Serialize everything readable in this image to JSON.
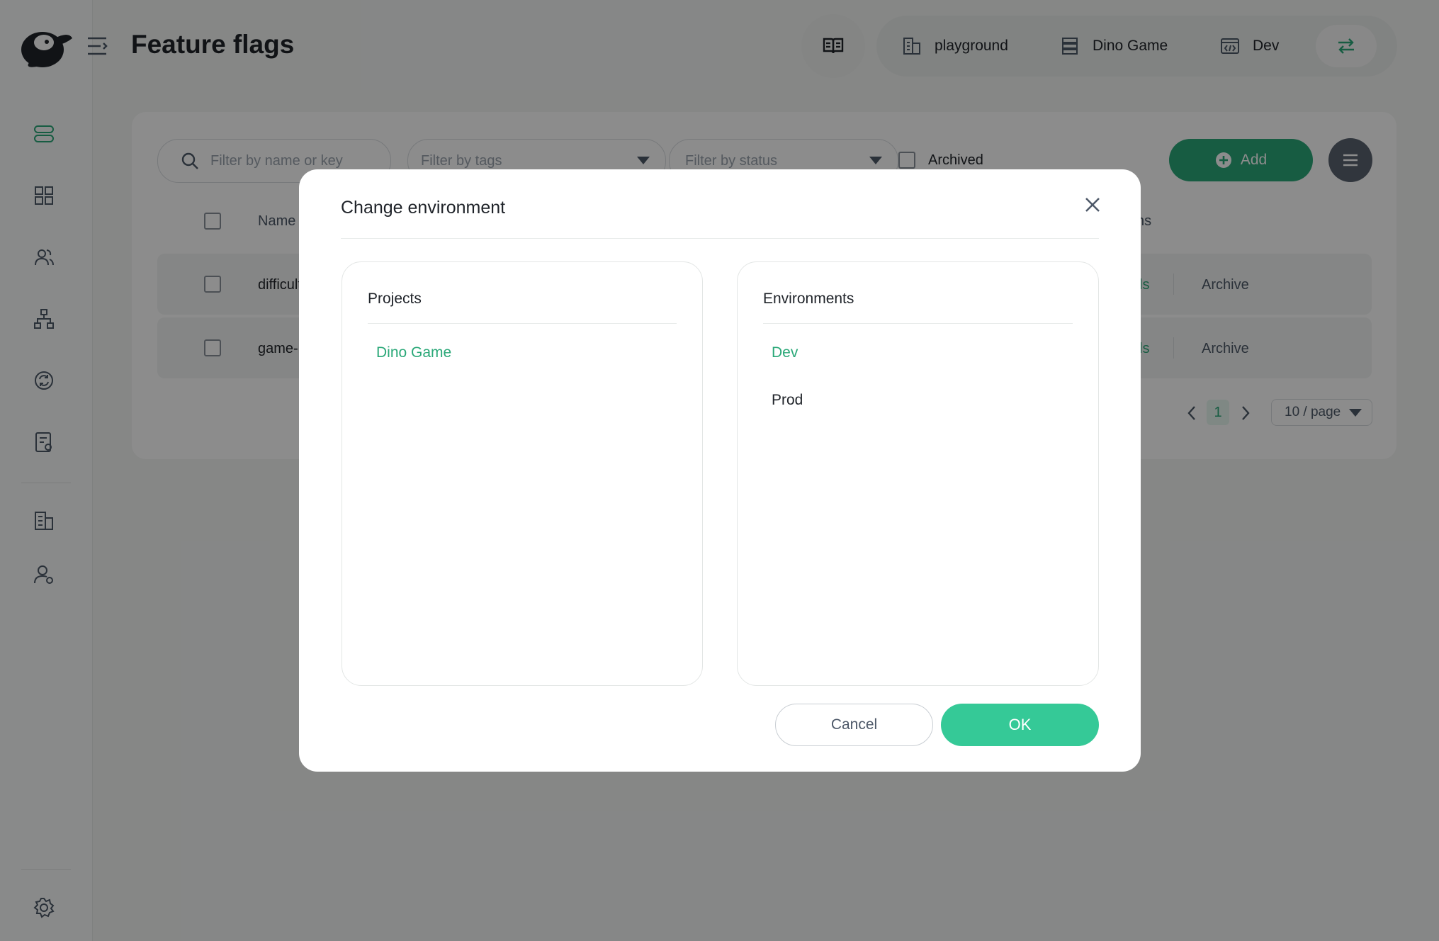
{
  "app": {
    "title": "Feature flags"
  },
  "header": {
    "organization": "playground",
    "project": "Dino Game",
    "environment": "Dev"
  },
  "filters": {
    "search_placeholder": "Filter by name or key",
    "tags_placeholder": "Filter by tags",
    "status_placeholder": "Filter by status",
    "archived_label": "Archived",
    "add_label": "Add"
  },
  "table": {
    "columns": {
      "name": "Name",
      "actions": "ns"
    },
    "rows": [
      {
        "name": "difficult",
        "details": "ls",
        "archive": "Archive"
      },
      {
        "name": "game-r",
        "details": "ls",
        "archive": "Archive"
      }
    ]
  },
  "pagination": {
    "current": "1",
    "page_size": "10 / page"
  },
  "modal": {
    "title": "Change environment",
    "projects_header": "Projects",
    "projects": [
      "Dino Game"
    ],
    "environments_header": "Environments",
    "environments": [
      "Dev",
      "Prod"
    ],
    "cancel_label": "Cancel",
    "ok_label": "OK"
  },
  "colors": {
    "accent": "#35c997",
    "accent_dark": "#2aa878",
    "selected_text": "#35c997"
  }
}
